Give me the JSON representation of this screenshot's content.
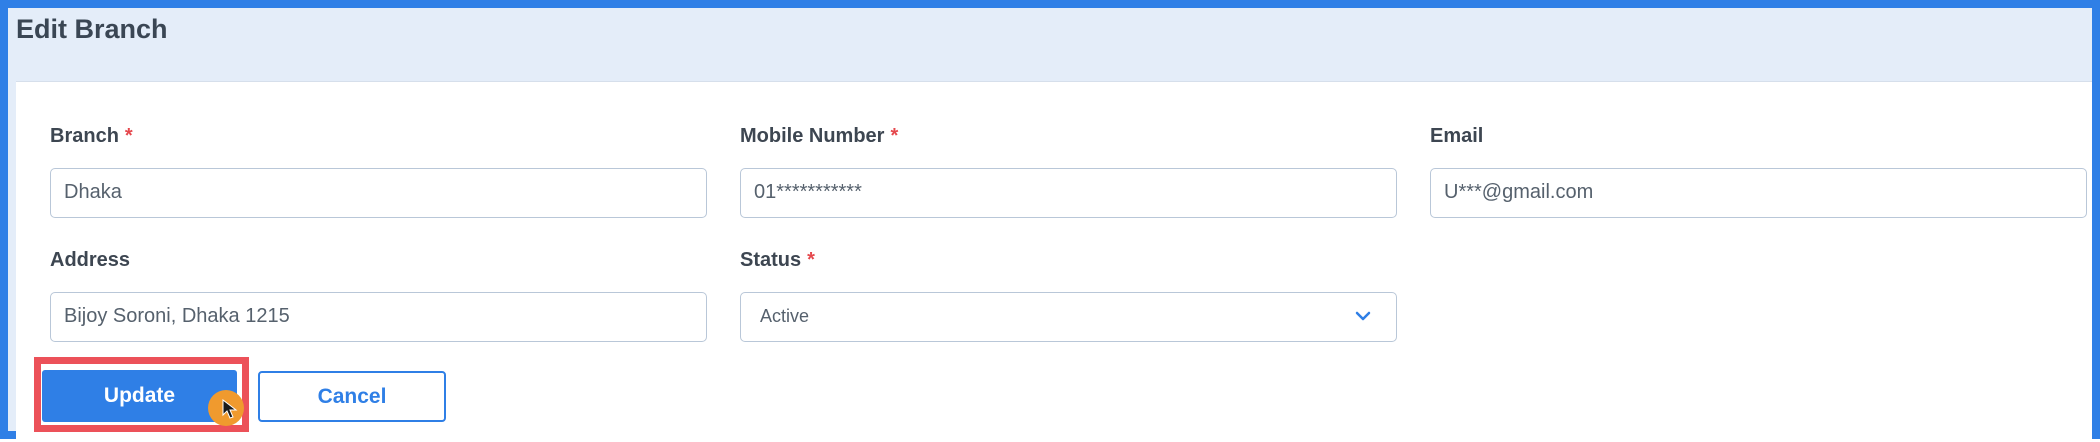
{
  "page": {
    "title": "Edit Branch"
  },
  "form": {
    "branch": {
      "label": "Branch",
      "required_mark": "*",
      "value": "Dhaka"
    },
    "mobile": {
      "label": "Mobile Number",
      "required_mark": "*",
      "value": "01***********"
    },
    "email": {
      "label": "Email",
      "value": "U***@gmail.com"
    },
    "address": {
      "label": "Address",
      "value": "Bijoy Soroni, Dhaka 1215"
    },
    "status": {
      "label": "Status",
      "required_mark": "*",
      "selected": "Active",
      "icon": "chevron-down-icon"
    }
  },
  "actions": {
    "update_label": "Update",
    "cancel_label": "Cancel"
  },
  "colors": {
    "accent": "#2f7fe6",
    "required": "#e5484d",
    "highlight": "#ec5159",
    "cursor": "#f09a2e",
    "header_bg": "#e4edf9"
  }
}
